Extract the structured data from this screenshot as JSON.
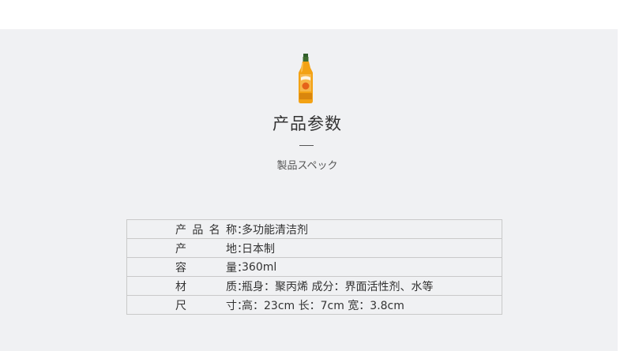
{
  "section": {
    "title": "产品参数",
    "subtitle": "製品スペック",
    "product_image_icon": "cleaner-bottle-icon"
  },
  "specs": [
    {
      "label": "产品名称",
      "colon": "：",
      "value": "多功能清洁剂"
    },
    {
      "label": "产地",
      "colon": "：",
      "value": "日本制"
    },
    {
      "label": "容量",
      "colon": "：",
      "value": "360ml"
    },
    {
      "label": "材质",
      "colon": "：",
      "value": "瓶身：聚丙烯 成分：界面活性剂、水等"
    },
    {
      "label": "尺寸",
      "colon": "：",
      "value": "高：23cm 长：7cm 宽：3.8cm"
    }
  ],
  "colors": {
    "panel_background": "#f0f1f3",
    "table_border": "#c9c9c9",
    "bottle_orange": "#f3a214",
    "bottle_cap": "#2f5d2a"
  }
}
